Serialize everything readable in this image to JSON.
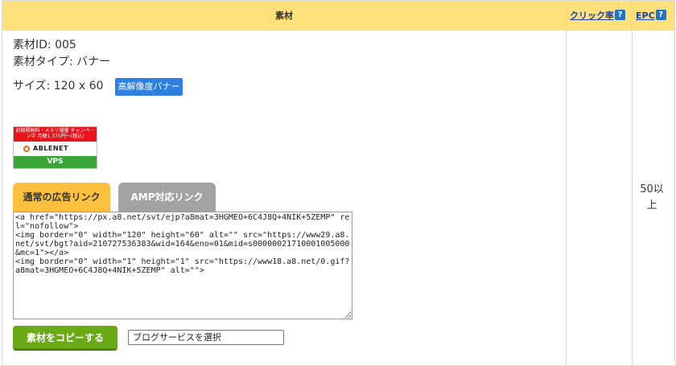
{
  "header": {
    "material": "素材",
    "click_rate": "クリック率",
    "epc": "EPC",
    "help_glyph": "?"
  },
  "material": {
    "id_line": "素材ID: 005",
    "type_line": "素材タイプ: バナー",
    "size_line": "サイズ: 120 x 60",
    "hires_badge": "高解像度バナー",
    "banner": {
      "top_text": "初期費無料・メモリ増量 キャンペーン中 月額1,375円〜(税込)",
      "brand": "ABLENET",
      "sub": "20年以上の安定実績",
      "os_text": "FXに最適なWindows Server",
      "product": "VPS"
    }
  },
  "tabs": {
    "normal": "通常の広告リンク",
    "amp": "AMP対応リンク"
  },
  "code": "<a href=\"https://px.a8.net/svt/ejp?a8mat=3HGMEO+6C4J8Q+4NIK+5ZEMP\" rel=\"nofollow\">\n<img border=\"0\" width=\"120\" height=\"60\" alt=\"\" src=\"https://www29.a8.net/svt/bgt?aid=210727536383&wid=164&eno=01&mid=s00000021710001005000&mc=1\"></a>\n<img border=\"0\" width=\"1\" height=\"1\" src=\"https://www18.a8.net/0.gif?a8mat=3HGMEO+6C4J8Q+4NIK+5ZEMP\" alt=\"\">",
  "copy_button": "素材をコピーする",
  "blog_select": "ブログサービスを選択",
  "epc_value": "50以上"
}
